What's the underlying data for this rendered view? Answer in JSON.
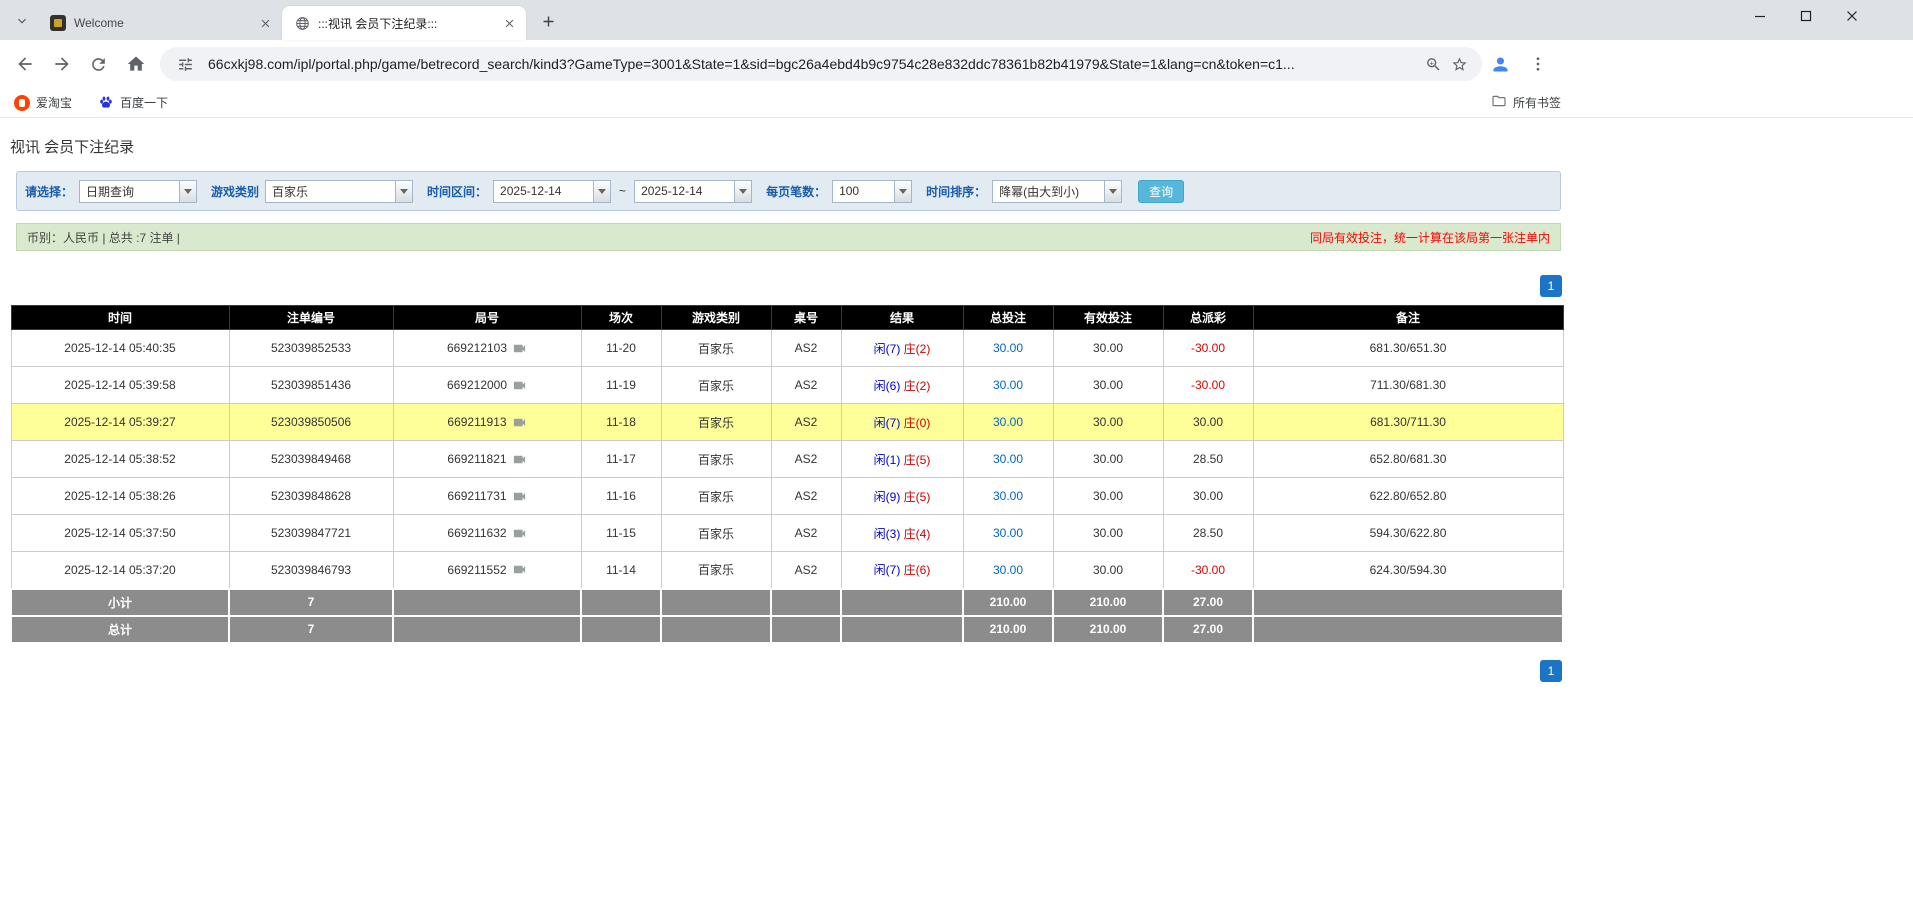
{
  "browser": {
    "tabs": [
      {
        "title": "Welcome"
      },
      {
        "title": ":::视讯 会员下注纪录:::"
      }
    ],
    "url": "66cxkj98.com/ipl/portal.php/game/betrecord_search/kind3?GameType=3001&State=1&sid=bgc26a4ebd4b9c9754c28e832ddc78361b82b41979&State=1&lang=cn&token=c1...",
    "bookmarks": [
      "爱淘宝",
      "百度一下"
    ],
    "all_bookmarks_label": "所有书签"
  },
  "page": {
    "title": "视讯 会员下注纪录",
    "filter": {
      "query_type_label": "请选择：",
      "query_type_value": "日期查询",
      "game_category_label": "游戏类别",
      "game_category_value": "百家乐",
      "time_range_label": "时间区间：",
      "date_from": "2025-12-14",
      "range_separator": "~",
      "date_to": "2025-12-14",
      "page_size_label": "每页笔数：",
      "page_size_value": "100",
      "sort_label": "时间排序：",
      "sort_value": "降幂(由大到小)",
      "search_button_label": "查询"
    },
    "info_bar": {
      "summary": "币别：人民币 | 总共 :7 注单 |",
      "notice": "同局有效投注，统一计算在该局第一张注单内"
    },
    "pagination_page": "1"
  },
  "table": {
    "headers": [
      "时间",
      "注单编号",
      "局号",
      "场次",
      "游戏类别",
      "桌号",
      "结果",
      "总投注",
      "有效投注",
      "总派彩",
      "备注"
    ],
    "rows": [
      {
        "time": "2025-12-14 05:40:35",
        "bet_no": "523039852533",
        "round": "669212103",
        "session": "11-20",
        "game": "百家乐",
        "table": "AS2",
        "player": "闲(7)",
        "banker": "庄(2)",
        "total_bet": "30.00",
        "valid_bet": "30.00",
        "payout": "-30.00",
        "remark": "681.30/651.30",
        "highlight": false
      },
      {
        "time": "2025-12-14 05:39:58",
        "bet_no": "523039851436",
        "round": "669212000",
        "session": "11-19",
        "game": "百家乐",
        "table": "AS2",
        "player": "闲(6)",
        "banker": "庄(2)",
        "total_bet": "30.00",
        "valid_bet": "30.00",
        "payout": "-30.00",
        "remark": "711.30/681.30",
        "highlight": false
      },
      {
        "time": "2025-12-14 05:39:27",
        "bet_no": "523039850506",
        "round": "669211913",
        "session": "11-18",
        "game": "百家乐",
        "table": "AS2",
        "player": "闲(7)",
        "banker": "庄(0)",
        "total_bet": "30.00",
        "valid_bet": "30.00",
        "payout": "30.00",
        "remark": "681.30/711.30",
        "highlight": true
      },
      {
        "time": "2025-12-14 05:38:52",
        "bet_no": "523039849468",
        "round": "669211821",
        "session": "11-17",
        "game": "百家乐",
        "table": "AS2",
        "player": "闲(1)",
        "banker": "庄(5)",
        "total_bet": "30.00",
        "valid_bet": "30.00",
        "payout": "28.50",
        "remark": "652.80/681.30",
        "highlight": false
      },
      {
        "time": "2025-12-14 05:38:26",
        "bet_no": "523039848628",
        "round": "669211731",
        "session": "11-16",
        "game": "百家乐",
        "table": "AS2",
        "player": "闲(9)",
        "banker": "庄(5)",
        "total_bet": "30.00",
        "valid_bet": "30.00",
        "payout": "30.00",
        "remark": "622.80/652.80",
        "highlight": false
      },
      {
        "time": "2025-12-14 05:37:50",
        "bet_no": "523039847721",
        "round": "669211632",
        "session": "11-15",
        "game": "百家乐",
        "table": "AS2",
        "player": "闲(3)",
        "banker": "庄(4)",
        "total_bet": "30.00",
        "valid_bet": "30.00",
        "payout": "28.50",
        "remark": "594.30/622.80",
        "highlight": false
      },
      {
        "time": "2025-12-14 05:37:20",
        "bet_no": "523039846793",
        "round": "669211552",
        "session": "11-14",
        "game": "百家乐",
        "table": "AS2",
        "player": "闲(7)",
        "banker": "庄(6)",
        "total_bet": "30.00",
        "valid_bet": "30.00",
        "payout": "-30.00",
        "remark": "624.30/594.30",
        "highlight": false
      }
    ],
    "summary_rows": [
      {
        "label": "小计",
        "count": "7",
        "total_bet": "210.00",
        "valid_bet": "210.00",
        "payout": "27.00"
      },
      {
        "label": "总计",
        "count": "7",
        "total_bet": "210.00",
        "valid_bet": "210.00",
        "payout": "27.00"
      }
    ]
  },
  "icons": {
    "tab_search": "chevron-down-icon",
    "tab_close": "close-icon",
    "new_tab": "plus-icon",
    "window_controls": [
      "minimize-icon",
      "maximize-icon",
      "close-icon"
    ],
    "navigation": [
      "back-arrow-icon",
      "forward-arrow-icon",
      "reload-icon",
      "home-icon"
    ],
    "address_bar": [
      "tune-icon",
      "zoom-in-icon",
      "star-icon"
    ],
    "toolbar_right": [
      "profile-avatar-icon",
      "kebab-menu-icon"
    ],
    "bookmarks": [
      "aitaobao-favicon",
      "baidu-paw-icon",
      "folder-icon"
    ],
    "round_cell": "camera-icon",
    "combo_arrow": "chevron-down-icon"
  },
  "colors": {
    "player_blue": "#0000cc",
    "banker_red": "#cc0000",
    "negative_red": "#e60000",
    "bet_link_blue": "#0066cc",
    "highlight_row": "#ffff99",
    "pager_blue": "#1b74c5",
    "search_button_blue": "#56b7da",
    "header_black": "#000000",
    "summary_gray": "#8c8c8c",
    "info_bar_green": "#d9e9cd",
    "filter_bar_blue": "#e2eaf2"
  }
}
